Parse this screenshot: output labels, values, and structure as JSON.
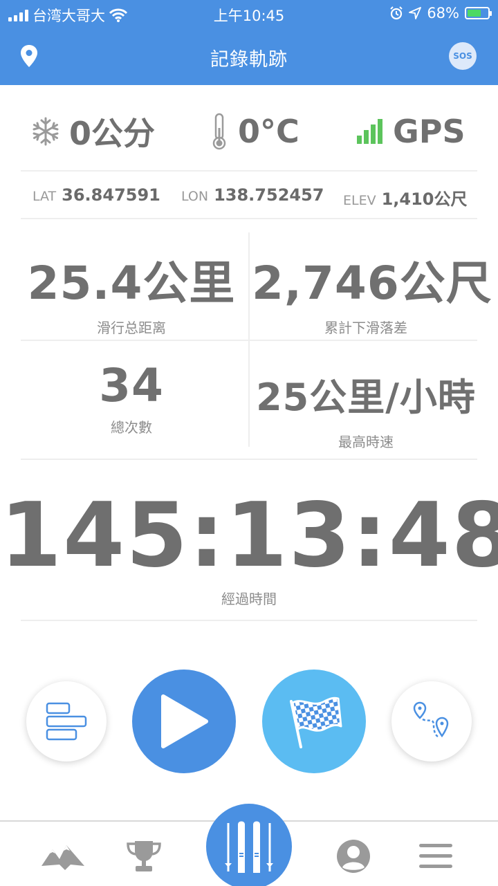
{
  "status_bar": {
    "carrier": "台湾大哥大",
    "time": "上午10:45",
    "battery": "68%",
    "battery_level": 0.68
  },
  "header": {
    "title": "記錄軌跡",
    "sos_label": "SOS"
  },
  "conditions": {
    "snow": "0公分",
    "temperature": "0°C",
    "gps": "GPS"
  },
  "coordinates": {
    "lat_label": "LAT",
    "lat": "36.847591",
    "lon_label": "LON",
    "lon": "138.752457",
    "elev_label": "ELEV",
    "elev": "1,410公尺"
  },
  "stats": {
    "distance_value": "25.4公里",
    "distance_label": "滑行总距离",
    "vertical_value": "2,746公尺",
    "vertical_label": "累計下滑落差",
    "runs_value": "34",
    "runs_label": "總次數",
    "speed_value": "25公里/小時",
    "speed_label": "最高時速"
  },
  "timer": {
    "value": "145:13:48",
    "label": "經過時間"
  },
  "colors": {
    "primary": "#4a90e2",
    "light_blue": "#5bbcf2",
    "gps_green": "#5cc45c",
    "text_gray": "#707070"
  },
  "icons": {
    "header_left": "location-pin-icon",
    "snow": "snowflake-icon",
    "temperature": "thermometer-icon",
    "gps": "signal-bars-icon",
    "stats_button": "bar-list-icon",
    "play_button": "play-icon",
    "finish_button": "checkered-flag-icon",
    "route_button": "route-pins-icon",
    "tabs": [
      "mountains-icon",
      "trophy-icon",
      "skis-icon",
      "user-avatar-icon",
      "hamburger-menu-icon"
    ]
  }
}
